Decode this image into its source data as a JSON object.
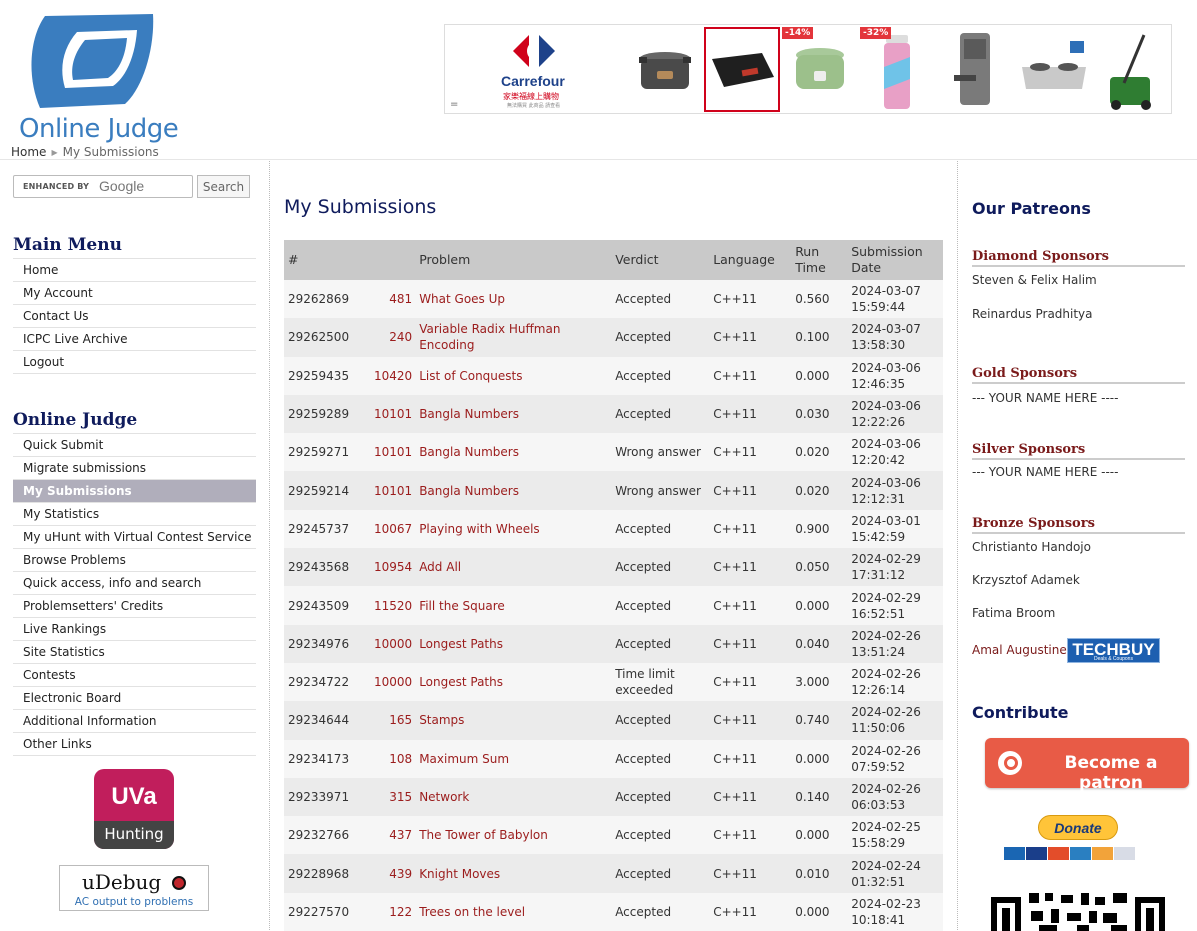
{
  "header": {
    "logo_text": "Online Judge",
    "breadcrumb": {
      "home": "Home",
      "current": "My Submissions"
    }
  },
  "ad": {
    "brand": "Carrefour",
    "brand_tagline": "家樂福線上購物",
    "brand_fine_print": "無法購買 此商品 請查看",
    "menu_glyph": "=",
    "discounts": [
      "-14%",
      "-32%"
    ],
    "colors": {
      "brand_blue": "#1e428a",
      "brand_red": "#d0021b",
      "badge": "#e3353b"
    }
  },
  "search": {
    "enhanced_by": "ENHANCED BY",
    "google_word": "Google",
    "button_label": "Search"
  },
  "main_menu": {
    "title": "Main Menu",
    "items": [
      "Home",
      "My Account",
      "Contact Us",
      "ICPC Live Archive",
      "Logout"
    ]
  },
  "oj_menu": {
    "title": "Online Judge",
    "active_index": 2,
    "items": [
      "Quick Submit",
      "Migrate submissions",
      "My Submissions",
      "My Statistics",
      "My uHunt with Virtual Contest Service",
      "Browse Problems",
      "Quick access, info and search",
      "Problemsetters' Credits",
      "Live Rankings",
      "Site Statistics",
      "Contests",
      "Electronic Board",
      "Additional Information",
      "Other Links"
    ]
  },
  "badges": {
    "uva_top": "UVa",
    "uva_bottom": "Hunting",
    "udebug_logo": "uDebug",
    "udebug_sub": "AC output to problems"
  },
  "main": {
    "title": "My Submissions",
    "columns": [
      "#",
      "Problem",
      "Verdict",
      "Language",
      "Run Time",
      "Submission Date"
    ],
    "rows": [
      {
        "id": "29262869",
        "pid": "481",
        "title": "What Goes Up",
        "verdict": "Accepted",
        "lang": "C++11",
        "time": "0.560",
        "date": "2024-03-07 15:59:44"
      },
      {
        "id": "29262500",
        "pid": "240",
        "title": "Variable Radix Huffman Encoding",
        "verdict": "Accepted",
        "lang": "C++11",
        "time": "0.100",
        "date": "2024-03-07 13:58:30"
      },
      {
        "id": "29259435",
        "pid": "10420",
        "title": "List of Conquests",
        "verdict": "Accepted",
        "lang": "C++11",
        "time": "0.000",
        "date": "2024-03-06 12:46:35"
      },
      {
        "id": "29259289",
        "pid": "10101",
        "title": "Bangla Numbers",
        "verdict": "Accepted",
        "lang": "C++11",
        "time": "0.030",
        "date": "2024-03-06 12:22:26"
      },
      {
        "id": "29259271",
        "pid": "10101",
        "title": "Bangla Numbers",
        "verdict": "Wrong answer",
        "lang": "C++11",
        "time": "0.020",
        "date": "2024-03-06 12:20:42"
      },
      {
        "id": "29259214",
        "pid": "10101",
        "title": "Bangla Numbers",
        "verdict": "Wrong answer",
        "lang": "C++11",
        "time": "0.020",
        "date": "2024-03-06 12:12:31"
      },
      {
        "id": "29245737",
        "pid": "10067",
        "title": "Playing with Wheels",
        "verdict": "Accepted",
        "lang": "C++11",
        "time": "0.900",
        "date": "2024-03-01 15:42:59"
      },
      {
        "id": "29243568",
        "pid": "10954",
        "title": "Add All",
        "verdict": "Accepted",
        "lang": "C++11",
        "time": "0.050",
        "date": "2024-02-29 17:31:12"
      },
      {
        "id": "29243509",
        "pid": "11520",
        "title": "Fill the Square",
        "verdict": "Accepted",
        "lang": "C++11",
        "time": "0.000",
        "date": "2024-02-29 16:52:51"
      },
      {
        "id": "29234976",
        "pid": "10000",
        "title": "Longest Paths",
        "verdict": "Accepted",
        "lang": "C++11",
        "time": "0.040",
        "date": "2024-02-26 13:51:24"
      },
      {
        "id": "29234722",
        "pid": "10000",
        "title": "Longest Paths",
        "verdict": "Time limit exceeded",
        "lang": "C++11",
        "time": "3.000",
        "date": "2024-02-26 12:26:14"
      },
      {
        "id": "29234644",
        "pid": "165",
        "title": "Stamps",
        "verdict": "Accepted",
        "lang": "C++11",
        "time": "0.740",
        "date": "2024-02-26 11:50:06"
      },
      {
        "id": "29234173",
        "pid": "108",
        "title": "Maximum Sum",
        "verdict": "Accepted",
        "lang": "C++11",
        "time": "0.000",
        "date": "2024-02-26 07:59:52"
      },
      {
        "id": "29233971",
        "pid": "315",
        "title": "Network",
        "verdict": "Accepted",
        "lang": "C++11",
        "time": "0.140",
        "date": "2024-02-26 06:03:53"
      },
      {
        "id": "29232766",
        "pid": "437",
        "title": "The Tower of Babylon",
        "verdict": "Accepted",
        "lang": "C++11",
        "time": "0.000",
        "date": "2024-02-25 15:58:29"
      },
      {
        "id": "29228968",
        "pid": "439",
        "title": "Knight Moves",
        "verdict": "Accepted",
        "lang": "C++11",
        "time": "0.010",
        "date": "2024-02-24 01:32:51"
      },
      {
        "id": "29227570",
        "pid": "122",
        "title": "Trees on the level",
        "verdict": "Accepted",
        "lang": "C++11",
        "time": "0.000",
        "date": "2024-02-23 10:18:41"
      }
    ]
  },
  "right": {
    "patreons_title": "Our Patreons",
    "diamond": {
      "title": "Diamond Sponsors",
      "names": [
        "Steven & Felix Halim",
        "Reinardus Pradhitya"
      ]
    },
    "gold": {
      "title": "Gold Sponsors",
      "names": [
        "--- YOUR NAME HERE ----"
      ]
    },
    "silver": {
      "title": "Silver Sponsors",
      "names": [
        "--- YOUR NAME HERE ----"
      ]
    },
    "bronze": {
      "title": "Bronze Sponsors",
      "names": [
        "Christianto Handojo",
        "Krzysztof Adamek",
        "Fatima Broom",
        "Amal Augustine"
      ]
    },
    "techbuy_label": "TECHBUY",
    "techbuy_small": "Deals & Coupons",
    "contribute_title": "Contribute",
    "patreon_button": "Become a patron",
    "donate_button": "Donate",
    "card_labels": [
      "Maestro",
      "VISA",
      "MasterCard",
      "AMEX",
      "",
      "Cuenta bancaria"
    ]
  },
  "colors": {
    "heading_navy": "#0f1b5c",
    "problem_red": "#9b1c1c",
    "active_menu": "#b0aebb",
    "table_header": "#c9c9c9",
    "patreon": "#e85b46"
  }
}
